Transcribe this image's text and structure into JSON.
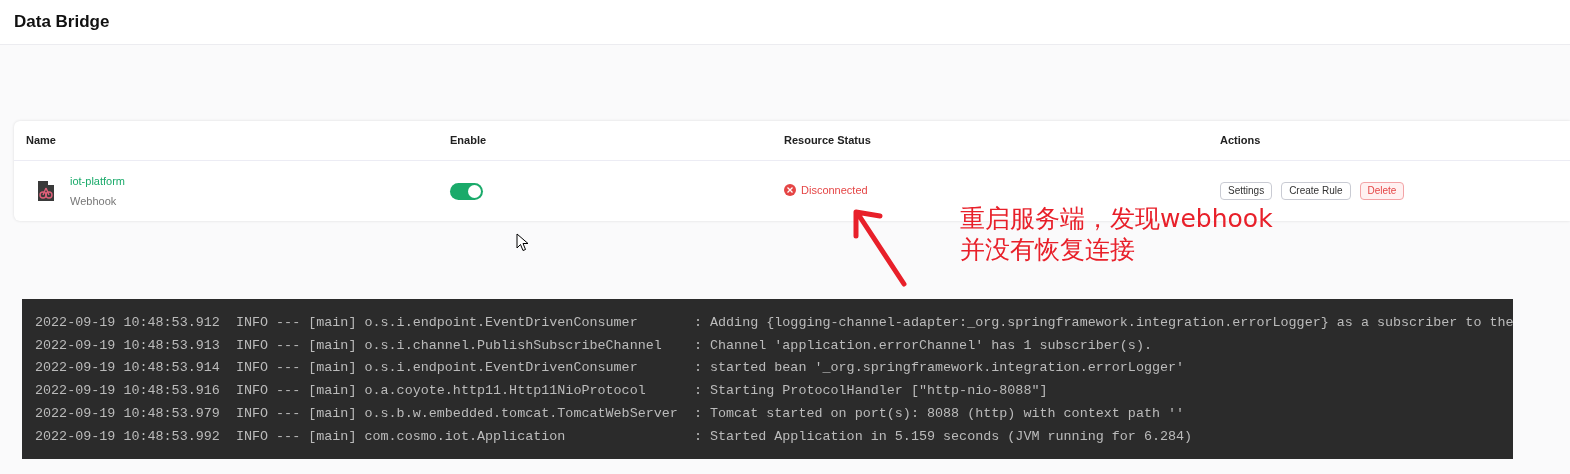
{
  "header": {
    "title": "Data Bridge"
  },
  "table": {
    "columns": [
      "Name",
      "Enable",
      "Resource Status",
      "Actions"
    ],
    "rows": [
      {
        "name": "iot-platform",
        "type": "Webhook",
        "enabled": true,
        "status": {
          "kind": "disconnected",
          "label": "Disconnected"
        },
        "actions": [
          {
            "label": "Settings",
            "kind": "default"
          },
          {
            "label": "Create Rule",
            "kind": "default"
          },
          {
            "label": "Delete",
            "kind": "danger"
          }
        ]
      }
    ]
  },
  "annotation": {
    "lines": [
      "重启服务端，发现webhook",
      "并没有恢复连接"
    ]
  },
  "console": {
    "lines": [
      "2022-09-19 10:48:53.912  INFO --- [main] o.s.i.endpoint.EventDrivenConsumer       : Adding {logging-channel-adapter:_org.springframework.integration.errorLogger} as a subscriber to the",
      "2022-09-19 10:48:53.913  INFO --- [main] o.s.i.channel.PublishSubscribeChannel    : Channel 'application.errorChannel' has 1 subscriber(s).",
      "2022-09-19 10:48:53.914  INFO --- [main] o.s.i.endpoint.EventDrivenConsumer       : started bean '_org.springframework.integration.errorLogger'",
      "2022-09-19 10:48:53.916  INFO --- [main] o.a.coyote.http11.Http11NioProtocol      : Starting ProtocolHandler [\"http-nio-8088\"]",
      "2022-09-19 10:48:53.979  INFO --- [main] o.s.b.w.embedded.tomcat.TomcatWebServer  : Tomcat started on port(s): 8088 (http) with context path ''",
      "2022-09-19 10:48:53.992  INFO --- [main] com.cosmo.iot.Application                : Started Application in 5.159 seconds (JVM running for 6.284)"
    ]
  }
}
